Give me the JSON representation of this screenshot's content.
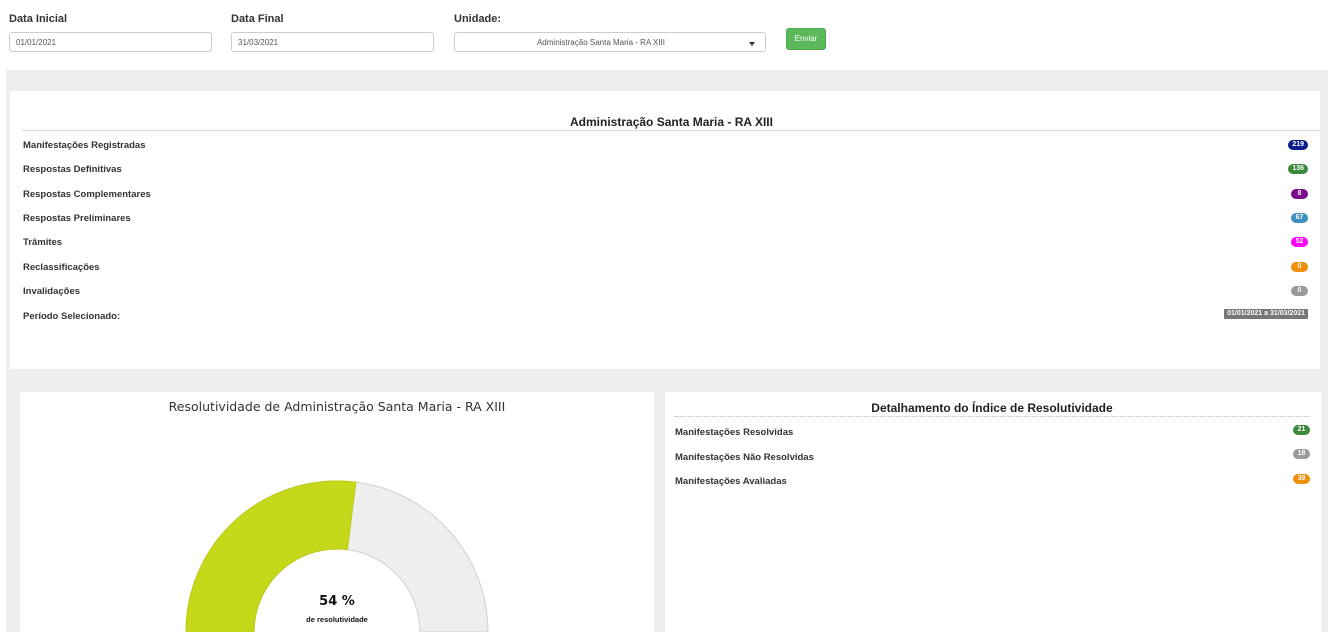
{
  "filters": {
    "start_label": "Data Inicial",
    "start_value": "01/01/2021",
    "end_label": "Data Final",
    "end_value": "31/03/2021",
    "unit_label": "Unidade:",
    "unit_value": "Administração Santa Maria - RA XIII",
    "submit_label": "Enviar"
  },
  "summary": {
    "title": "Administração Santa Maria - RA XIII",
    "rows": [
      {
        "label": "Manifestações Registradas",
        "value": "219",
        "color": "#0a1b8a"
      },
      {
        "label": "Respostas Definitivas",
        "value": "136",
        "color": "#3c8a3c"
      },
      {
        "label": "Respostas Complementares",
        "value": "8",
        "color": "#7b0b8c"
      },
      {
        "label": "Respostas Preliminares",
        "value": "67",
        "color": "#3f8fbf"
      },
      {
        "label": "Trâmites",
        "value": "52",
        "color": "#ff00ff"
      },
      {
        "label": "Reclassificações",
        "value": "0",
        "color": "#f0900a"
      },
      {
        "label": "Invalidações",
        "value": "0",
        "color": "#999999"
      }
    ],
    "period_label": "Período Selecionado:",
    "period_value": "01/01/2021 a 31/03/2021"
  },
  "gauge": {
    "title": "Resolutividade de Administração Santa Maria - RA XIII",
    "percent": 54,
    "value_text": "54 %",
    "caption": "de resolutividade",
    "fill_color": "#c5d81a",
    "track_color": "#eeeeee"
  },
  "detail": {
    "title": "Detalhamento do Índice de Resolutividade",
    "rows": [
      {
        "label": "Manifestações Resolvidas",
        "value": "21",
        "color": "#3c8a3c"
      },
      {
        "label": "Manifestações Não Resolvidas",
        "value": "18",
        "color": "#999999"
      },
      {
        "label": "Manifestações Avaliadas",
        "value": "39",
        "color": "#f0900a"
      }
    ]
  }
}
